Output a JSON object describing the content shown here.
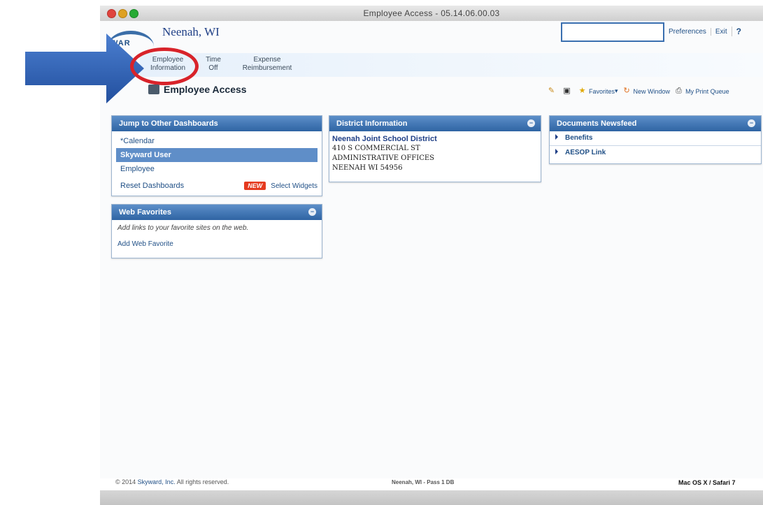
{
  "window": {
    "title": "Employee Access - 05.14.06.00.03"
  },
  "header": {
    "site_name": "Neenah, WI",
    "logo_text": "WAR",
    "search": {
      "value": "",
      "placeholder": ""
    },
    "links": {
      "preferences": "Preferences",
      "exit": "Exit",
      "help": "?"
    }
  },
  "nav": {
    "tabs": [
      {
        "line1": "Employee",
        "line2": "Information"
      },
      {
        "line1": "Time",
        "line2": "Off"
      },
      {
        "line1": "Expense",
        "line2": "Reimbursement"
      }
    ]
  },
  "page": {
    "title": "Employee Access"
  },
  "toolbar": {
    "favorites": "Favorites",
    "new_window": "New Window",
    "print_queue": "My Print Queue"
  },
  "dashboards": {
    "title": "Jump to Other Dashboards",
    "items": [
      "*Calendar",
      "Skyward User",
      "Employee"
    ],
    "reset": "Reset Dashboards",
    "new_badge": "NEW",
    "select_widgets": "Select Widgets"
  },
  "web_favorites": {
    "title": "Web Favorites",
    "hint": "Add links to your favorite sites on the web.",
    "add": "Add Web Favorite"
  },
  "district": {
    "title": "District Information",
    "name": "Neenah Joint School District",
    "address1": "410 S COMMERCIAL ST",
    "address2": "ADMINISTRATIVE OFFICES",
    "city": "NEENAH WI 54956"
  },
  "documents": {
    "title": "Documents Newsfeed",
    "items": [
      "Benefits",
      "AESOP Link"
    ]
  },
  "footer": {
    "copyright": "© 2014",
    "brand": "Skyward, Inc.",
    "rights": "All rights reserved.",
    "db": "Neenah, WI - Pass 1 DB",
    "platform": "Mac OS X / Safari 7"
  },
  "colors": {
    "panel_header": "#2f64a3",
    "link": "#1f4f86",
    "annotation_ring": "#d8232a",
    "annotation_arrow": "#2f5fb3"
  }
}
